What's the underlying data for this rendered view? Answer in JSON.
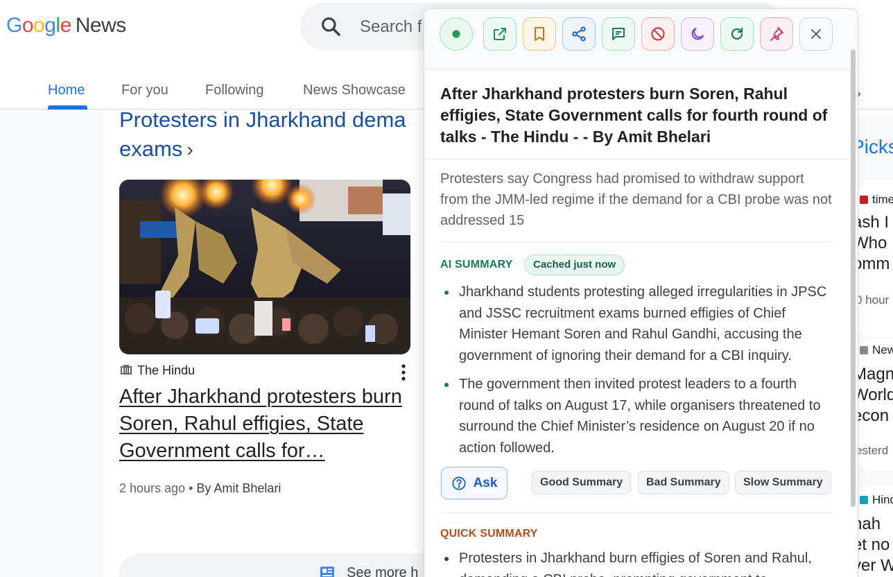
{
  "app": {
    "logo_word_google": [
      "G",
      "o",
      "o",
      "g",
      "l",
      "e"
    ],
    "logo_word_news": "News",
    "search_placeholder": "Search f"
  },
  "nav": {
    "tabs": [
      {
        "label": "Home",
        "active": true
      },
      {
        "label": "For you",
        "active": false
      },
      {
        "label": "Following",
        "active": false
      },
      {
        "label": "News Showcase",
        "active": false
      }
    ],
    "overflow_glyph": "›"
  },
  "story": {
    "heading": "Protesters in Jharkhand dema",
    "heading_line2": "exams",
    "heading_chevron": "›",
    "source": "The Hindu",
    "title": "After Jharkhand protesters burn Soren, Rahul effigies, State Government calls for…",
    "time": "2 hours ago",
    "separator": " • ",
    "author": "By Amit Bhelari",
    "see_more": "See more h"
  },
  "right_column": {
    "picks": "Picks",
    "items": [
      {
        "source": "time",
        "dot_color": "#c5221f",
        "lines": [
          "ash I",
          "Who",
          "omm"
        ],
        "time": "0 hour"
      },
      {
        "source": "New",
        "dot_color": "#8a8a8a",
        "lines": [
          "Magn",
          "World",
          "econ"
        ],
        "time": "esterd"
      },
      {
        "source": "Hind",
        "dot_color": "#12a4b4",
        "lines": [
          "hah",
          "et no",
          "ver W"
        ],
        "time": ""
      }
    ]
  },
  "panel": {
    "toolbar": [
      {
        "name": "status-button",
        "icon": "status-dot-icon",
        "border": "#a8dcc0",
        "bg": "#e9f7ef",
        "color": "#1e9b57"
      },
      {
        "name": "open-external-button",
        "icon": "external-link-icon",
        "border": "#a9dcc4",
        "bg": "#eef9f3",
        "color": "#1e8e66"
      },
      {
        "name": "bookmark-button",
        "icon": "bookmark-icon",
        "border": "#f1c27c",
        "bg": "#fdf5e6",
        "color": "#c77a10"
      },
      {
        "name": "share-button",
        "icon": "share-icon",
        "border": "#a9c4f2",
        "bg": "#eef4fd",
        "color": "#1a5fd0"
      },
      {
        "name": "comment-button",
        "icon": "comment-icon",
        "border": "#a9dcc4",
        "bg": "#eef9f3",
        "color": "#18785a"
      },
      {
        "name": "block-button",
        "icon": "block-icon",
        "border": "#f1a9a9",
        "bg": "#fdf0f0",
        "color": "#d33b3b"
      },
      {
        "name": "dark-mode-button",
        "icon": "moon-icon",
        "border": "#d0b5f2",
        "bg": "#f6f0fd",
        "color": "#7b3fd6"
      },
      {
        "name": "refresh-button",
        "icon": "refresh-icon",
        "border": "#a9dcc4",
        "bg": "#eef9f3",
        "color": "#18785a"
      },
      {
        "name": "pin-button",
        "icon": "pin-icon",
        "border": "#f1a9c4",
        "bg": "#fdf0f5",
        "color": "#d4306a"
      },
      {
        "name": "close-button",
        "icon": "close-icon",
        "border": "#cfd3d8",
        "bg": "#f8f9fa",
        "color": "#5f6368"
      }
    ],
    "title": "After Jharkhand protesters burn Soren, Rahul effigies, State Government calls for fourth round of talks - The Hindu - - By Amit Bhelari",
    "description": "Protesters say Congress had promised to withdraw support from the JMM-led regime if the demand for a CBI probe was not addressed 15",
    "ai_summary_label": "AI SUMMARY",
    "cached_badge": "Cached just now",
    "ai_bullets": [
      "Jharkhand students protesting alleged irregularities in JPSC and JSSC recruitment exams burned effigies of Chief Minister Hemant Soren and Rahul Gandhi, accusing the government of ignoring their demand for a CBI inquiry.",
      "The government then invited protest leaders to a fourth round of talks on August 17, while organisers threatened to surround the Chief Minister’s residence on August 20 if no action followed."
    ],
    "ask_label": "Ask",
    "feedback_buttons": [
      "Good Summary",
      "Bad Summary",
      "Slow Summary"
    ],
    "quick_summary_label": "QUICK SUMMARY",
    "quick_bullets": [
      "Protesters in Jharkhand burn effigies of Soren and Rahul, demanding a CBI probe, prompting government to"
    ]
  }
}
